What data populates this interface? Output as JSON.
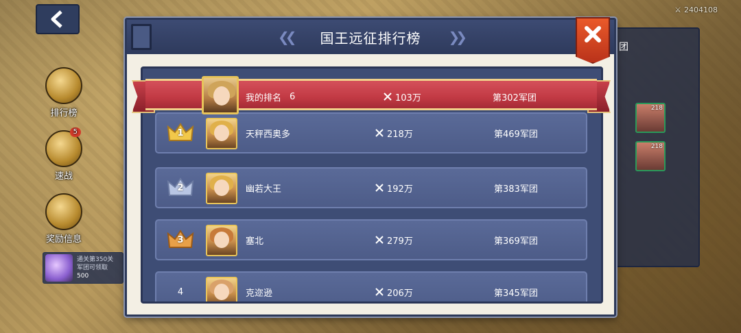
{
  "hud": {
    "power_value": "2404108"
  },
  "side_menu": {
    "items": [
      {
        "label": "排行榜"
      },
      {
        "label": "速战",
        "badge": "5"
      },
      {
        "label": "奖励信息"
      }
    ],
    "reward_text_line1": "通关第350关",
    "reward_text_line2": "军团可领取",
    "reward_amount": "500"
  },
  "behind_panel": {
    "slot_levels": [
      "218",
      "218"
    ],
    "partial_text": "团"
  },
  "modal": {
    "title": "国王远征排行榜",
    "my_rank": {
      "label": "我的排名",
      "rank": "6",
      "power": "103万",
      "legion": "第302军团"
    },
    "rows": [
      {
        "rank": "1",
        "name": "天秤西奥多",
        "power": "218万",
        "legion": "第469军团"
      },
      {
        "rank": "2",
        "name": "幽若大王",
        "power": "192万",
        "legion": "第383军团"
      },
      {
        "rank": "3",
        "name": "塞北",
        "power": "279万",
        "legion": "第369军团"
      },
      {
        "rank": "4",
        "name": "克迩逊",
        "power": "206万",
        "legion": "第345军团"
      }
    ]
  },
  "colors": {
    "header_bg": "#2e3a5c",
    "row_bg": "#4d5c88",
    "ribbon_red": "#c23a44",
    "close_orange": "#d8401f",
    "gold_crown": "#f2c84a",
    "silver_crown": "#b9c6e4",
    "bronze_crown": "#e8a048"
  }
}
